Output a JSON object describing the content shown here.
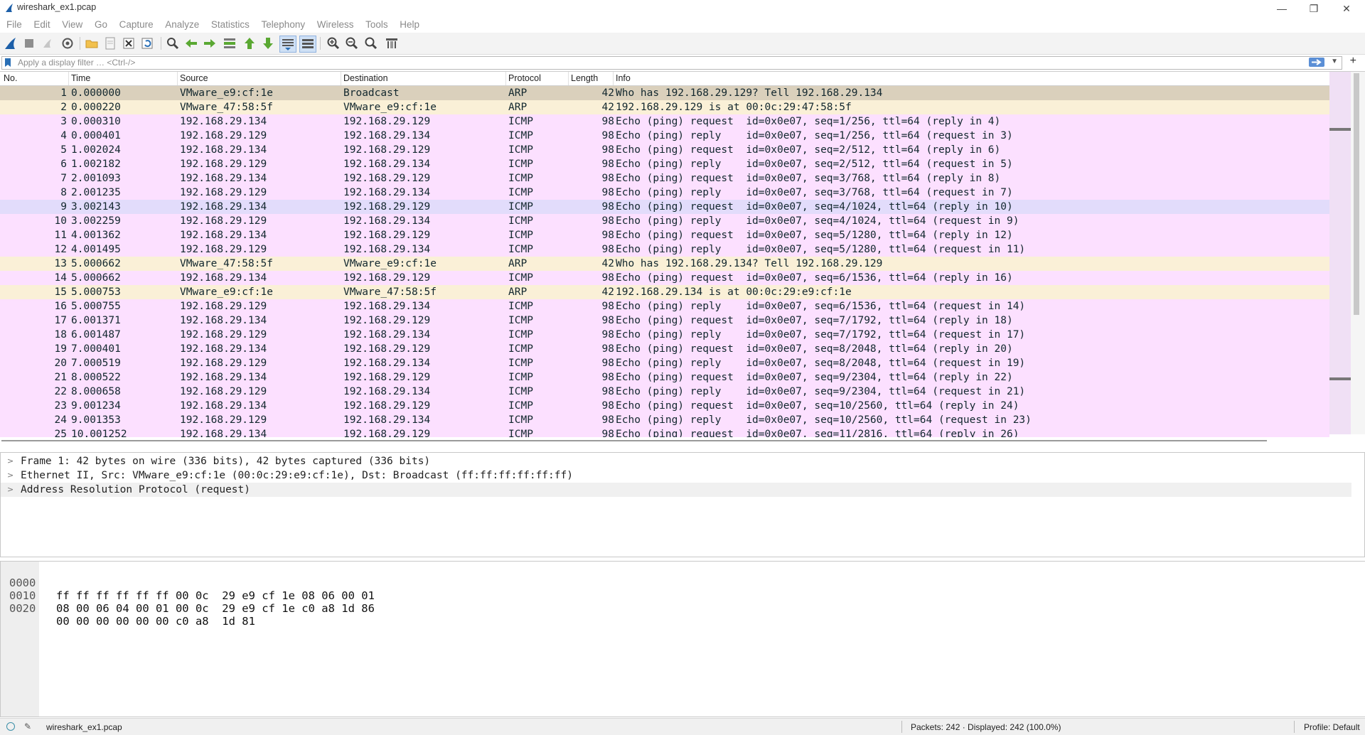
{
  "window": {
    "title": "wireshark_ex1.pcap",
    "minimize": "—",
    "restore": "❐",
    "close": "✕"
  },
  "menu": [
    "File",
    "Edit",
    "View",
    "Go",
    "Capture",
    "Analyze",
    "Statistics",
    "Telephony",
    "Wireless",
    "Tools",
    "Help"
  ],
  "toolbar_icons": [
    "shark-fin-start-icon",
    "stop-icon",
    "restart-icon",
    "options-gear-icon",
    "open-folder-icon",
    "save-file-icon",
    "close-file-icon",
    "reload-icon",
    "find-icon",
    "back-arrow-icon",
    "forward-arrow-icon",
    "go-to-packet-icon",
    "first-packet-icon",
    "last-packet-icon",
    "autoscroll-icon",
    "colorize-icon",
    "zoom-in-icon",
    "zoom-out-icon",
    "normal-size-icon",
    "resize-columns-icon"
  ],
  "filter": {
    "placeholder": "Apply a display filter … <Ctrl-/>",
    "plus": "+"
  },
  "columns": [
    "No.",
    "Time",
    "Source",
    "Destination",
    "Protocol",
    "Length",
    "Info"
  ],
  "packets": [
    {
      "no": "1",
      "time": "0.000000",
      "src": "VMware_e9:cf:1e",
      "dst": "Broadcast",
      "proto": "ARP",
      "len": "42",
      "info": "Who has 192.168.29.129? Tell 192.168.29.134",
      "kind": "sel"
    },
    {
      "no": "2",
      "time": "0.000220",
      "src": "VMware_47:58:5f",
      "dst": "VMware_e9:cf:1e",
      "proto": "ARP",
      "len": "42",
      "info": "192.168.29.129 is at 00:0c:29:47:58:5f",
      "kind": "arp"
    },
    {
      "no": "3",
      "time": "0.000310",
      "src": "192.168.29.134",
      "dst": "192.168.29.129",
      "proto": "ICMP",
      "len": "98",
      "info": "Echo (ping) request  id=0x0e07, seq=1/256, ttl=64 (reply in 4)",
      "kind": "icmp"
    },
    {
      "no": "4",
      "time": "0.000401",
      "src": "192.168.29.129",
      "dst": "192.168.29.134",
      "proto": "ICMP",
      "len": "98",
      "info": "Echo (ping) reply    id=0x0e07, seq=1/256, ttl=64 (request in 3)",
      "kind": "icmp"
    },
    {
      "no": "5",
      "time": "1.002024",
      "src": "192.168.29.134",
      "dst": "192.168.29.129",
      "proto": "ICMP",
      "len": "98",
      "info": "Echo (ping) request  id=0x0e07, seq=2/512, ttl=64 (reply in 6)",
      "kind": "icmp"
    },
    {
      "no": "6",
      "time": "1.002182",
      "src": "192.168.29.129",
      "dst": "192.168.29.134",
      "proto": "ICMP",
      "len": "98",
      "info": "Echo (ping) reply    id=0x0e07, seq=2/512, ttl=64 (request in 5)",
      "kind": "icmp"
    },
    {
      "no": "7",
      "time": "2.001093",
      "src": "192.168.29.134",
      "dst": "192.168.29.129",
      "proto": "ICMP",
      "len": "98",
      "info": "Echo (ping) request  id=0x0e07, seq=3/768, ttl=64 (reply in 8)",
      "kind": "icmp"
    },
    {
      "no": "8",
      "time": "2.001235",
      "src": "192.168.29.129",
      "dst": "192.168.29.134",
      "proto": "ICMP",
      "len": "98",
      "info": "Echo (ping) reply    id=0x0e07, seq=3/768, ttl=64 (request in 7)",
      "kind": "icmp"
    },
    {
      "no": "9",
      "time": "3.002143",
      "src": "192.168.29.134",
      "dst": "192.168.29.129",
      "proto": "ICMP",
      "len": "98",
      "info": "Echo (ping) request  id=0x0e07, seq=4/1024, ttl=64 (reply in 10)",
      "kind": "hov"
    },
    {
      "no": "10",
      "time": "3.002259",
      "src": "192.168.29.129",
      "dst": "192.168.29.134",
      "proto": "ICMP",
      "len": "98",
      "info": "Echo (ping) reply    id=0x0e07, seq=4/1024, ttl=64 (request in 9)",
      "kind": "icmp"
    },
    {
      "no": "11",
      "time": "4.001362",
      "src": "192.168.29.134",
      "dst": "192.168.29.129",
      "proto": "ICMP",
      "len": "98",
      "info": "Echo (ping) request  id=0x0e07, seq=5/1280, ttl=64 (reply in 12)",
      "kind": "icmp"
    },
    {
      "no": "12",
      "time": "4.001495",
      "src": "192.168.29.129",
      "dst": "192.168.29.134",
      "proto": "ICMP",
      "len": "98",
      "info": "Echo (ping) reply    id=0x0e07, seq=5/1280, ttl=64 (request in 11)",
      "kind": "icmp"
    },
    {
      "no": "13",
      "time": "5.000662",
      "src": "VMware_47:58:5f",
      "dst": "VMware_e9:cf:1e",
      "proto": "ARP",
      "len": "42",
      "info": "Who has 192.168.29.134? Tell 192.168.29.129",
      "kind": "arp"
    },
    {
      "no": "14",
      "time": "5.000662",
      "src": "192.168.29.134",
      "dst": "192.168.29.129",
      "proto": "ICMP",
      "len": "98",
      "info": "Echo (ping) request  id=0x0e07, seq=6/1536, ttl=64 (reply in 16)",
      "kind": "icmp"
    },
    {
      "no": "15",
      "time": "5.000753",
      "src": "VMware_e9:cf:1e",
      "dst": "VMware_47:58:5f",
      "proto": "ARP",
      "len": "42",
      "info": "192.168.29.134 is at 00:0c:29:e9:cf:1e",
      "kind": "arp"
    },
    {
      "no": "16",
      "time": "5.000755",
      "src": "192.168.29.129",
      "dst": "192.168.29.134",
      "proto": "ICMP",
      "len": "98",
      "info": "Echo (ping) reply    id=0x0e07, seq=6/1536, ttl=64 (request in 14)",
      "kind": "icmp"
    },
    {
      "no": "17",
      "time": "6.001371",
      "src": "192.168.29.134",
      "dst": "192.168.29.129",
      "proto": "ICMP",
      "len": "98",
      "info": "Echo (ping) request  id=0x0e07, seq=7/1792, ttl=64 (reply in 18)",
      "kind": "icmp"
    },
    {
      "no": "18",
      "time": "6.001487",
      "src": "192.168.29.129",
      "dst": "192.168.29.134",
      "proto": "ICMP",
      "len": "98",
      "info": "Echo (ping) reply    id=0x0e07, seq=7/1792, ttl=64 (request in 17)",
      "kind": "icmp"
    },
    {
      "no": "19",
      "time": "7.000401",
      "src": "192.168.29.134",
      "dst": "192.168.29.129",
      "proto": "ICMP",
      "len": "98",
      "info": "Echo (ping) request  id=0x0e07, seq=8/2048, ttl=64 (reply in 20)",
      "kind": "icmp"
    },
    {
      "no": "20",
      "time": "7.000519",
      "src": "192.168.29.129",
      "dst": "192.168.29.134",
      "proto": "ICMP",
      "len": "98",
      "info": "Echo (ping) reply    id=0x0e07, seq=8/2048, ttl=64 (request in 19)",
      "kind": "icmp"
    },
    {
      "no": "21",
      "time": "8.000522",
      "src": "192.168.29.134",
      "dst": "192.168.29.129",
      "proto": "ICMP",
      "len": "98",
      "info": "Echo (ping) request  id=0x0e07, seq=9/2304, ttl=64 (reply in 22)",
      "kind": "icmp"
    },
    {
      "no": "22",
      "time": "8.000658",
      "src": "192.168.29.129",
      "dst": "192.168.29.134",
      "proto": "ICMP",
      "len": "98",
      "info": "Echo (ping) reply    id=0x0e07, seq=9/2304, ttl=64 (request in 21)",
      "kind": "icmp"
    },
    {
      "no": "23",
      "time": "9.001234",
      "src": "192.168.29.134",
      "dst": "192.168.29.129",
      "proto": "ICMP",
      "len": "98",
      "info": "Echo (ping) request  id=0x0e07, seq=10/2560, ttl=64 (reply in 24)",
      "kind": "icmp"
    },
    {
      "no": "24",
      "time": "9.001353",
      "src": "192.168.29.129",
      "dst": "192.168.29.134",
      "proto": "ICMP",
      "len": "98",
      "info": "Echo (ping) reply    id=0x0e07, seq=10/2560, ttl=64 (request in 23)",
      "kind": "icmp"
    },
    {
      "no": "25",
      "time": "10.001252",
      "src": "192.168.29.134",
      "dst": "192.168.29.129",
      "proto": "ICMP",
      "len": "98",
      "info": "Echo (ping) request  id=0x0e07, seq=11/2816, ttl=64 (reply in 26)",
      "kind": "icmp"
    }
  ],
  "details": [
    "Frame 1: 42 bytes on wire (336 bits), 42 bytes captured (336 bits)",
    "Ethernet II, Src: VMware_e9:cf:1e (00:0c:29:e9:cf:1e), Dst: Broadcast (ff:ff:ff:ff:ff:ff)",
    "Address Resolution Protocol (request)"
  ],
  "hex": [
    {
      "off": "0000",
      "bytes": "ff ff ff ff ff ff 00 0c  29 e9 cf 1e 08 06 00 01"
    },
    {
      "off": "0010",
      "bytes": "08 00 06 04 00 01 00 0c  29 e9 cf 1e c0 a8 1d 86"
    },
    {
      "off": "0020",
      "bytes": "00 00 00 00 00 00 c0 a8  1d 81"
    }
  ],
  "status": {
    "file": "wireshark_ex1.pcap",
    "packets": "Packets: 242 · Displayed: 242 (100.0%)",
    "profile": "Profile: Default"
  },
  "colors": {
    "arp_row": "#faf0d7",
    "icmp_row": "#fce0ff",
    "selected_row": "#dad0bc",
    "hover_row": "#e2dcfb"
  }
}
